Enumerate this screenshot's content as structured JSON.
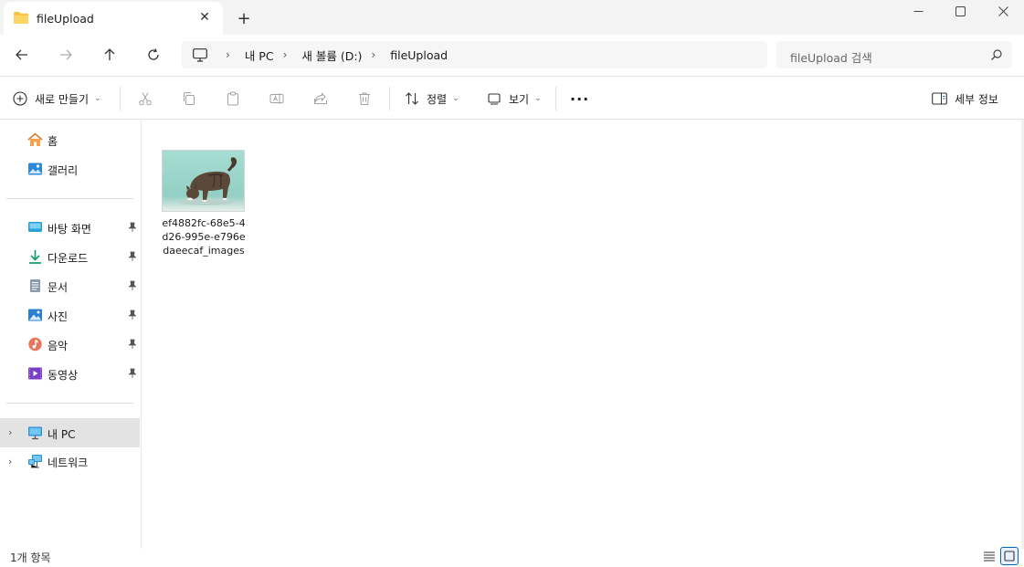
{
  "window": {
    "tab_title": "fileUpload",
    "new_tab": "+",
    "close_tab": "✕"
  },
  "breadcrumb": {
    "items": [
      "내 PC",
      "새 볼륨 (D:)",
      "fileUpload"
    ]
  },
  "search": {
    "placeholder": "fileUpload 검색"
  },
  "commands": {
    "new": "새로 만들기",
    "sort": "정렬",
    "view": "보기",
    "more": "···",
    "details": "세부 정보"
  },
  "sidebar": {
    "top": [
      {
        "label": "홈",
        "icon": "home-icon"
      },
      {
        "label": "갤러리",
        "icon": "gallery-icon"
      }
    ],
    "quick": [
      {
        "label": "바탕 화면",
        "icon": "desktop-icon"
      },
      {
        "label": "다운로드",
        "icon": "download-icon"
      },
      {
        "label": "문서",
        "icon": "documents-icon"
      },
      {
        "label": "사진",
        "icon": "pictures-icon"
      },
      {
        "label": "음악",
        "icon": "music-icon"
      },
      {
        "label": "동영상",
        "icon": "videos-icon"
      }
    ],
    "tree": [
      {
        "label": "내 PC",
        "icon": "pc-icon",
        "selected": true
      },
      {
        "label": "네트워크",
        "icon": "network-icon",
        "selected": false
      }
    ]
  },
  "files": [
    {
      "name": "ef4882fc-68e5-4d26-995e-e796edaeecaf_images",
      "thumbnail": "cat-photo",
      "lines": [
        "ef4882fc-68e5-4",
        "d26-995e-e796e",
        "daeecaf_images"
      ]
    }
  ],
  "status": {
    "count": "1개 항목"
  },
  "colors": {
    "accent": "#0067c0",
    "folder": "#f8c444",
    "thumb_bg": "#9fd5cc"
  }
}
